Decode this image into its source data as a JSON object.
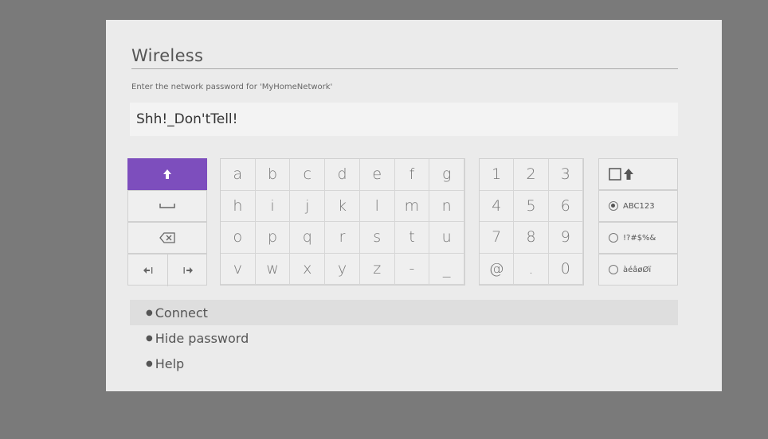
{
  "screen": {
    "title": "Wireless",
    "prompt": "Enter the network password for 'MyHomeNetwork'",
    "password_value": "Shh!_Don'tTell!"
  },
  "function_keys": {
    "shift_icon": "shift-arrow-icon",
    "space_icon": "space-bar-icon",
    "backspace_icon": "backspace-icon",
    "cursor_left_icon": "cursor-left-icon",
    "cursor_right_icon": "cursor-right-icon",
    "shift_active_color": "#7d4ebd"
  },
  "letter_keys": [
    "a",
    "b",
    "c",
    "d",
    "e",
    "f",
    "g",
    "h",
    "i",
    "j",
    "k",
    "l",
    "m",
    "n",
    "o",
    "p",
    "q",
    "r",
    "s",
    "t",
    "u",
    "v",
    "w",
    "x",
    "y",
    "z",
    "-",
    "_"
  ],
  "digit_keys": [
    "1",
    "2",
    "3",
    "4",
    "5",
    "6",
    "7",
    "8",
    "9",
    "@",
    ".",
    "0"
  ],
  "mode_keys": {
    "caps_lock_icon": "caps-lock-icon",
    "options": [
      {
        "label": "ABC123",
        "selected": true
      },
      {
        "label": "!?#$%&",
        "selected": false
      },
      {
        "label": "àéâøØï",
        "selected": false
      }
    ]
  },
  "menu": [
    {
      "label": "Connect",
      "selected": true
    },
    {
      "label": "Hide password",
      "selected": false
    },
    {
      "label": "Help",
      "selected": false
    }
  ]
}
